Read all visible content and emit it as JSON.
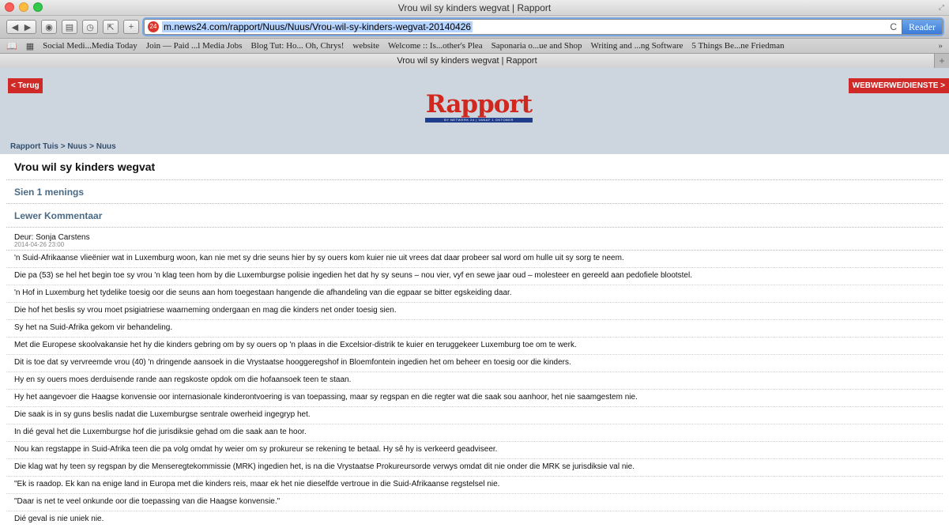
{
  "window": {
    "title": "Vrou wil sy kinders wegvat | Rapport"
  },
  "toolbar": {
    "url": "m.news24.com/rapport/Nuus/Nuus/Vrou-wil-sy-kinders-wegvat-20140426",
    "reader_label": "Reader"
  },
  "bookmarks": [
    "Social Medi...Media Today",
    "Join — Paid ...l Media Jobs",
    "Blog Tut: Ho... Oh, Chrys!",
    "website",
    "Welcome :: Is...other's Plea",
    "Saponaria o...ue and Shop",
    "Writing and ...ng Software",
    "5 Things Be...ne Friedman"
  ],
  "tab": {
    "label": "Vrou wil sy kinders wegvat | Rapport"
  },
  "header": {
    "back_label": "< Terug",
    "services_label": "WEBWERWE/DIENSTE >",
    "logo_text": "Rapport",
    "logo_strip_text": "BY NETWERK 24 | VANAF 1 OKTOBER",
    "breadcrumb": "Rapport Tuis > Nuus > Nuus"
  },
  "article": {
    "title": "Vrou wil sy kinders wegvat",
    "comments_link": "Sien 1 menings",
    "add_comment_link": "Lewer Kommentaar",
    "author": "Deur: Sonja Carstens",
    "date": "2014-04-26 23:00",
    "paragraphs": [
      "'n Suid-Afrikaanse vlieënier wat in Luxemburg woon, kan nie met sy drie seuns hier by sy ouers kom kuier nie uit vrees dat daar probeer sal word om hulle uit sy sorg te neem.",
      "Die pa (53) se hel het begin toe sy vrou 'n klag teen hom by die Luxemburgse polisie ingedien het dat hy sy seuns – nou vier, vyf en sewe jaar oud – molesteer en gereeld aan pedofiele blootstel.",
      "'n Hof in Luxemburg het tydelike toesig oor die seuns aan hom toegestaan hangende die afhandeling van die egpaar se bitter egskeiding daar.",
      "Die hof het beslis sy vrou moet psigiatriese waarneming ondergaan en mag die kinders net onder toesig sien.",
      "Sy het na Suid-Afrika gekom vir behandeling.",
      "Met die Europese skoolvakansie het hy die kinders gebring om by sy ouers op 'n plaas in die Excelsior-distrik te kuier en teruggekeer Luxemburg toe om te werk.",
      "Dit is toe dat sy vervreemde vrou (40) 'n dringende aansoek in die Vrystaatse hooggeregshof in Bloemfontein ingedien het om beheer en toesig oor die kinders.",
      "Hy en sy ouers moes derduisende rande aan regskoste opdok om die hofaansoek teen te staan.",
      "Hy het aangevoer die Haagse konvensie oor internasionale kinderontvoering is van toepassing, maar sy regspan en die regter wat die saak sou aanhoor, het nie saamgestem nie.",
      "Die saak is in sy guns beslis nadat die Luxemburgse sentrale owerheid ingegryp het.",
      "In dié geval het die Luxemburgse hof die jurisdiksie gehad om die saak aan te hoor.",
      "Nou kan regstappe in Suid-Afrika teen die pa volg omdat hy weier om sy prokureur se rekening te betaal. Hy sê hy is verkeerd geadviseer.",
      "Die klag wat hy teen sy regspan by die Menseregtekommissie (MRK) ingedien het, is na die Vrystaatse Prokureursorde verwys omdat dit nie onder die MRK se jurisdiksie val nie.",
      "\"Ek is raadop. Ek kan na enige land in Europa met die kinders reis, maar ek het nie dieselfde vertroue in die Suid-Afrikaanse regstelsel nie.",
      "\"Daar is net te veel onkunde oor die toepassing van die Haagse konvensie.\"",
      "Dié geval is nie uniek nie."
    ]
  }
}
